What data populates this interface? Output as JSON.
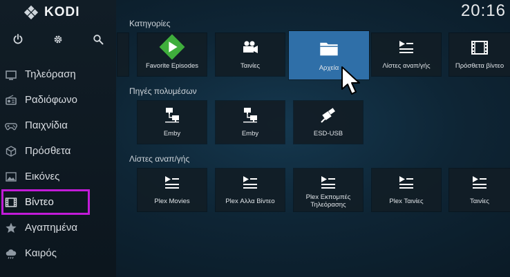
{
  "app": {
    "title": "KODI",
    "clock": "20:16"
  },
  "colors": {
    "accent": "#2f6fa8",
    "highlight": "#c21bd8",
    "green": "#3fae3c"
  },
  "top_icons": [
    {
      "name": "power-icon"
    },
    {
      "name": "gear-icon"
    },
    {
      "name": "search-icon"
    }
  ],
  "sidebar": {
    "items": [
      {
        "label": "Τηλεόραση",
        "icon": "tv-icon"
      },
      {
        "label": "Ραδιόφωνο",
        "icon": "radio-icon"
      },
      {
        "label": "Παιχνίδια",
        "icon": "gamepad-icon"
      },
      {
        "label": "Πρόσθετα",
        "icon": "box-icon"
      },
      {
        "label": "Εικόνες",
        "icon": "image-icon"
      },
      {
        "label": "Βίντεο",
        "icon": "film-icon",
        "selected": true
      },
      {
        "label": "Αγαπημένα",
        "icon": "star-icon"
      },
      {
        "label": "Καιρός",
        "icon": "cloud-icon"
      }
    ]
  },
  "sections": {
    "categories": {
      "label": "Κατηγορίες",
      "tiles": [
        {
          "label": "Favorite Episodes",
          "icon": "play-diamond-icon"
        },
        {
          "label": "Ταινίες",
          "icon": "movie-camera-icon"
        },
        {
          "label": "Αρχεία",
          "icon": "folder-icon",
          "focused": true
        },
        {
          "label": "Λίστες αναπ/γής",
          "icon": "playlist-icon"
        },
        {
          "label": "Πρόσθετα βίντεο",
          "icon": "film-icon"
        }
      ]
    },
    "media_sources": {
      "label": "Πηγές πολυμέσων",
      "tiles": [
        {
          "label": "Emby",
          "icon": "network-icon"
        },
        {
          "label": "Emby",
          "icon": "network-icon"
        },
        {
          "label": "ESD-USB",
          "icon": "usb-icon"
        }
      ]
    },
    "playlists": {
      "label": "Λίστες αναπ/γής",
      "tiles": [
        {
          "label": "Plex Movies",
          "icon": "playlist-icon"
        },
        {
          "label": "Plex Αλλα Βίντεο",
          "icon": "playlist-icon"
        },
        {
          "label": "Plex Εκπομπές Τηλεόρασης",
          "icon": "playlist-icon"
        },
        {
          "label": "Plex Ταινίες",
          "icon": "playlist-icon"
        },
        {
          "label": "Ταινίες",
          "icon": "playlist-icon"
        }
      ]
    }
  }
}
